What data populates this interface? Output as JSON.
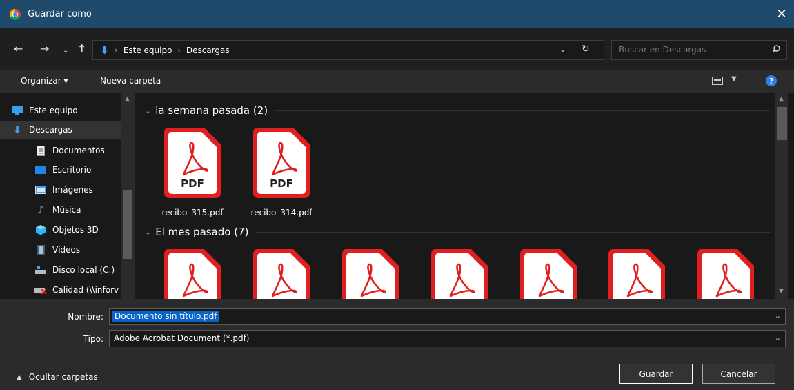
{
  "window": {
    "title": "Guardar como",
    "close_glyph": "✕"
  },
  "address": {
    "crumbs": [
      "Este equipo",
      "Descargas"
    ],
    "search_placeholder": "Buscar en Descargas"
  },
  "toolbar": {
    "organize_label": "Organizar ▾",
    "new_folder_label": "Nueva carpeta",
    "help_label": "?"
  },
  "sidebar": {
    "items": [
      {
        "label": "Este equipo",
        "icon": "computer-icon"
      },
      {
        "label": "Descargas",
        "icon": "download-icon",
        "selected": true
      },
      {
        "label": "Documentos",
        "icon": "documents-icon"
      },
      {
        "label": "Escritorio",
        "icon": "desktop-icon"
      },
      {
        "label": "Imágenes",
        "icon": "pictures-icon"
      },
      {
        "label": "Música",
        "icon": "music-icon"
      },
      {
        "label": "Objetos 3D",
        "icon": "objects-3d-icon"
      },
      {
        "label": "Vídeos",
        "icon": "videos-icon"
      },
      {
        "label": "Disco local (C:)",
        "icon": "disk-icon"
      },
      {
        "label": "Calidad (\\\\inforv",
        "icon": "network-drive-icon"
      }
    ]
  },
  "groups": [
    {
      "header": "la semana pasada (2)",
      "files": [
        "recibo_315.pdf",
        "recibo_314.pdf"
      ]
    },
    {
      "header": "El mes pasado (7)",
      "files": [
        "",
        "",
        "",
        "",
        "",
        "",
        ""
      ]
    }
  ],
  "pdf_badge": "PDF",
  "form": {
    "name_label": "Nombre:",
    "name_value": "Documento sin título.pdf",
    "type_label": "Tipo:",
    "type_value": "Adobe Acrobat Document (*.pdf)"
  },
  "buttons": {
    "save": "Guardar",
    "cancel": "Cancelar",
    "hide_folders": "Ocultar carpetas"
  },
  "colors": {
    "accent": "#0a64c8",
    "pdf_red": "#e02020",
    "title_bar": "#1f4a6b"
  }
}
